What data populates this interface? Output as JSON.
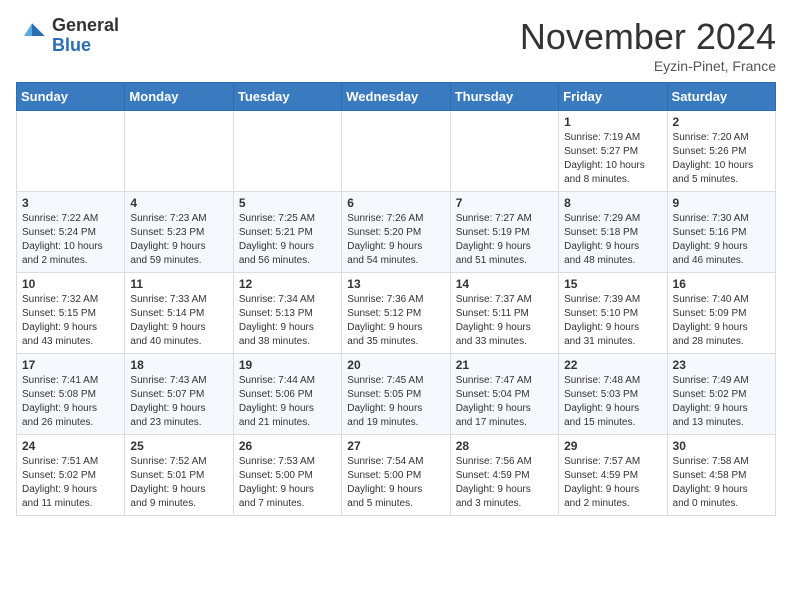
{
  "header": {
    "logo_general": "General",
    "logo_blue": "Blue",
    "month_title": "November 2024",
    "location": "Eyzin-Pinet, France"
  },
  "calendar": {
    "days_of_week": [
      "Sunday",
      "Monday",
      "Tuesday",
      "Wednesday",
      "Thursday",
      "Friday",
      "Saturday"
    ],
    "weeks": [
      [
        {
          "day": "",
          "info": ""
        },
        {
          "day": "",
          "info": ""
        },
        {
          "day": "",
          "info": ""
        },
        {
          "day": "",
          "info": ""
        },
        {
          "day": "",
          "info": ""
        },
        {
          "day": "1",
          "info": "Sunrise: 7:19 AM\nSunset: 5:27 PM\nDaylight: 10 hours\nand 8 minutes."
        },
        {
          "day": "2",
          "info": "Sunrise: 7:20 AM\nSunset: 5:26 PM\nDaylight: 10 hours\nand 5 minutes."
        }
      ],
      [
        {
          "day": "3",
          "info": "Sunrise: 7:22 AM\nSunset: 5:24 PM\nDaylight: 10 hours\nand 2 minutes."
        },
        {
          "day": "4",
          "info": "Sunrise: 7:23 AM\nSunset: 5:23 PM\nDaylight: 9 hours\nand 59 minutes."
        },
        {
          "day": "5",
          "info": "Sunrise: 7:25 AM\nSunset: 5:21 PM\nDaylight: 9 hours\nand 56 minutes."
        },
        {
          "day": "6",
          "info": "Sunrise: 7:26 AM\nSunset: 5:20 PM\nDaylight: 9 hours\nand 54 minutes."
        },
        {
          "day": "7",
          "info": "Sunrise: 7:27 AM\nSunset: 5:19 PM\nDaylight: 9 hours\nand 51 minutes."
        },
        {
          "day": "8",
          "info": "Sunrise: 7:29 AM\nSunset: 5:18 PM\nDaylight: 9 hours\nand 48 minutes."
        },
        {
          "day": "9",
          "info": "Sunrise: 7:30 AM\nSunset: 5:16 PM\nDaylight: 9 hours\nand 46 minutes."
        }
      ],
      [
        {
          "day": "10",
          "info": "Sunrise: 7:32 AM\nSunset: 5:15 PM\nDaylight: 9 hours\nand 43 minutes."
        },
        {
          "day": "11",
          "info": "Sunrise: 7:33 AM\nSunset: 5:14 PM\nDaylight: 9 hours\nand 40 minutes."
        },
        {
          "day": "12",
          "info": "Sunrise: 7:34 AM\nSunset: 5:13 PM\nDaylight: 9 hours\nand 38 minutes."
        },
        {
          "day": "13",
          "info": "Sunrise: 7:36 AM\nSunset: 5:12 PM\nDaylight: 9 hours\nand 35 minutes."
        },
        {
          "day": "14",
          "info": "Sunrise: 7:37 AM\nSunset: 5:11 PM\nDaylight: 9 hours\nand 33 minutes."
        },
        {
          "day": "15",
          "info": "Sunrise: 7:39 AM\nSunset: 5:10 PM\nDaylight: 9 hours\nand 31 minutes."
        },
        {
          "day": "16",
          "info": "Sunrise: 7:40 AM\nSunset: 5:09 PM\nDaylight: 9 hours\nand 28 minutes."
        }
      ],
      [
        {
          "day": "17",
          "info": "Sunrise: 7:41 AM\nSunset: 5:08 PM\nDaylight: 9 hours\nand 26 minutes."
        },
        {
          "day": "18",
          "info": "Sunrise: 7:43 AM\nSunset: 5:07 PM\nDaylight: 9 hours\nand 23 minutes."
        },
        {
          "day": "19",
          "info": "Sunrise: 7:44 AM\nSunset: 5:06 PM\nDaylight: 9 hours\nand 21 minutes."
        },
        {
          "day": "20",
          "info": "Sunrise: 7:45 AM\nSunset: 5:05 PM\nDaylight: 9 hours\nand 19 minutes."
        },
        {
          "day": "21",
          "info": "Sunrise: 7:47 AM\nSunset: 5:04 PM\nDaylight: 9 hours\nand 17 minutes."
        },
        {
          "day": "22",
          "info": "Sunrise: 7:48 AM\nSunset: 5:03 PM\nDaylight: 9 hours\nand 15 minutes."
        },
        {
          "day": "23",
          "info": "Sunrise: 7:49 AM\nSunset: 5:02 PM\nDaylight: 9 hours\nand 13 minutes."
        }
      ],
      [
        {
          "day": "24",
          "info": "Sunrise: 7:51 AM\nSunset: 5:02 PM\nDaylight: 9 hours\nand 11 minutes."
        },
        {
          "day": "25",
          "info": "Sunrise: 7:52 AM\nSunset: 5:01 PM\nDaylight: 9 hours\nand 9 minutes."
        },
        {
          "day": "26",
          "info": "Sunrise: 7:53 AM\nSunset: 5:00 PM\nDaylight: 9 hours\nand 7 minutes."
        },
        {
          "day": "27",
          "info": "Sunrise: 7:54 AM\nSunset: 5:00 PM\nDaylight: 9 hours\nand 5 minutes."
        },
        {
          "day": "28",
          "info": "Sunrise: 7:56 AM\nSunset: 4:59 PM\nDaylight: 9 hours\nand 3 minutes."
        },
        {
          "day": "29",
          "info": "Sunrise: 7:57 AM\nSunset: 4:59 PM\nDaylight: 9 hours\nand 2 minutes."
        },
        {
          "day": "30",
          "info": "Sunrise: 7:58 AM\nSunset: 4:58 PM\nDaylight: 9 hours\nand 0 minutes."
        }
      ]
    ]
  }
}
